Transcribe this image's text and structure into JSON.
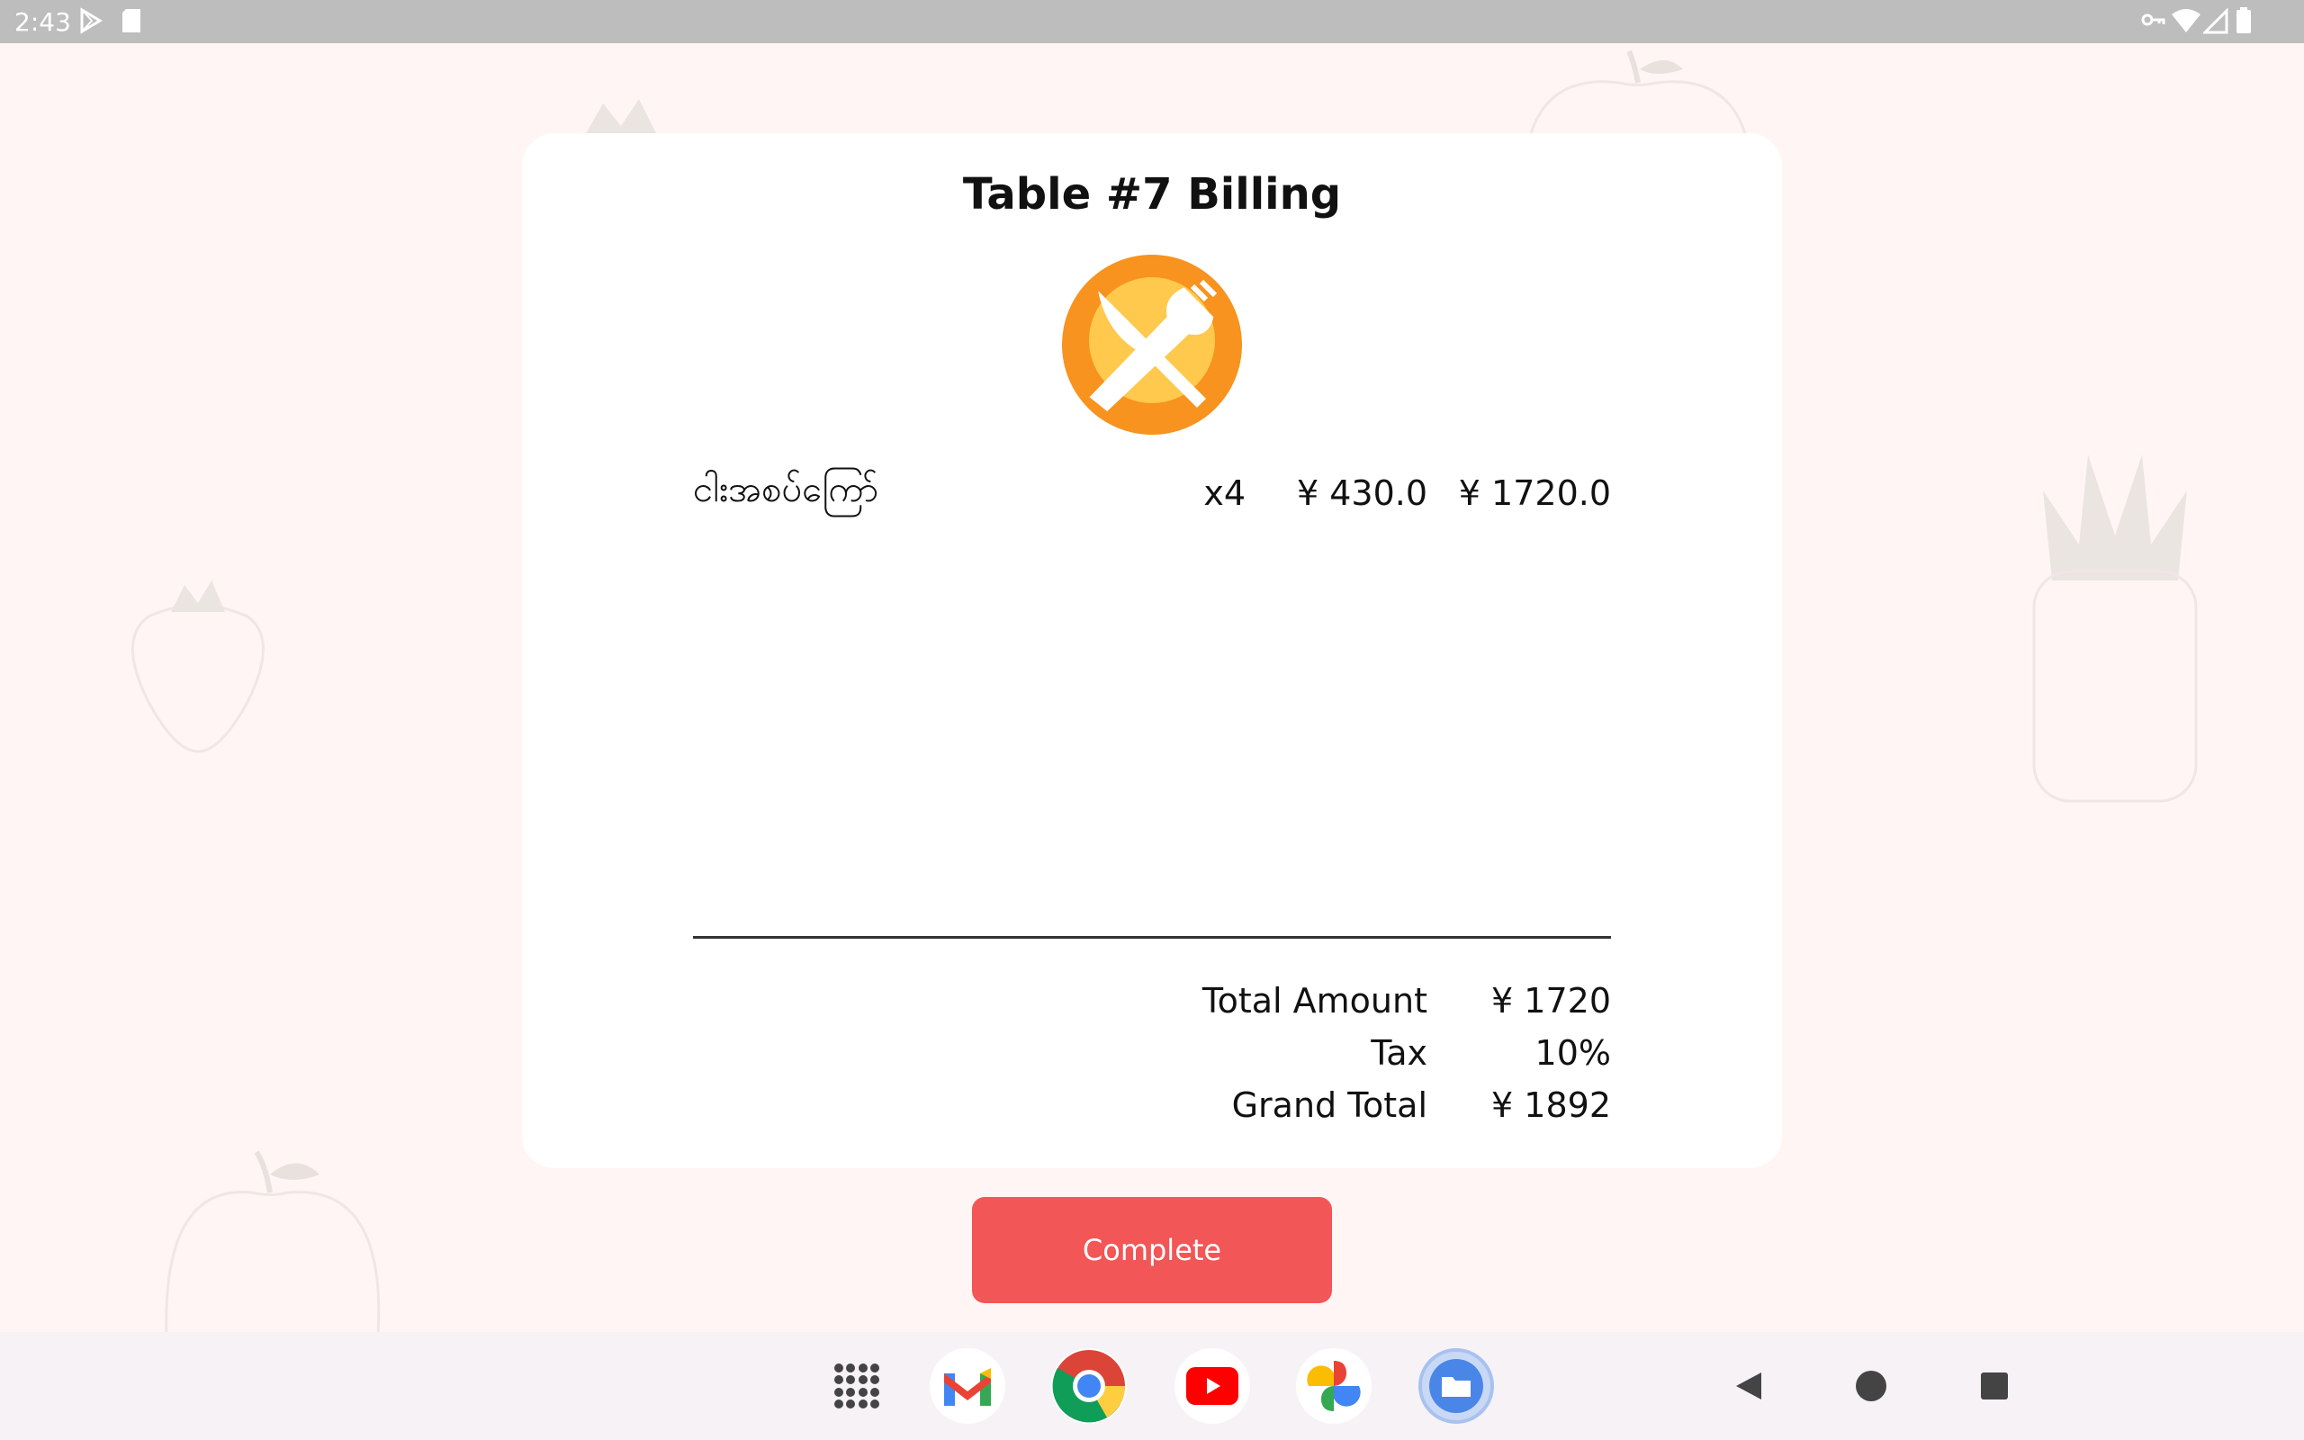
{
  "status_bar": {
    "time": "2:43"
  },
  "billing": {
    "title": "Table #7 Billing",
    "items": [
      {
        "name": "ငါးအစပ်ကြော်",
        "qty": "x4",
        "price": "¥ 430.0",
        "total": "¥ 1720.0"
      }
    ],
    "summary": {
      "total_amount_label": "Total Amount",
      "total_amount_value": "¥ 1720",
      "tax_label": "Tax",
      "tax_value": "10%",
      "grand_total_label": "Grand Total",
      "grand_total_value": "¥ 1892"
    }
  },
  "actions": {
    "complete_label": "Complete"
  },
  "colors": {
    "accent": "#f25656",
    "logo_orange": "#f7931e",
    "logo_yellow": "#ffc94d"
  },
  "dock": [
    "apps-grid-icon",
    "gmail-icon",
    "chrome-icon",
    "youtube-icon",
    "photos-icon",
    "files-icon"
  ],
  "nav": [
    "back-icon",
    "home-icon",
    "recents-icon"
  ]
}
